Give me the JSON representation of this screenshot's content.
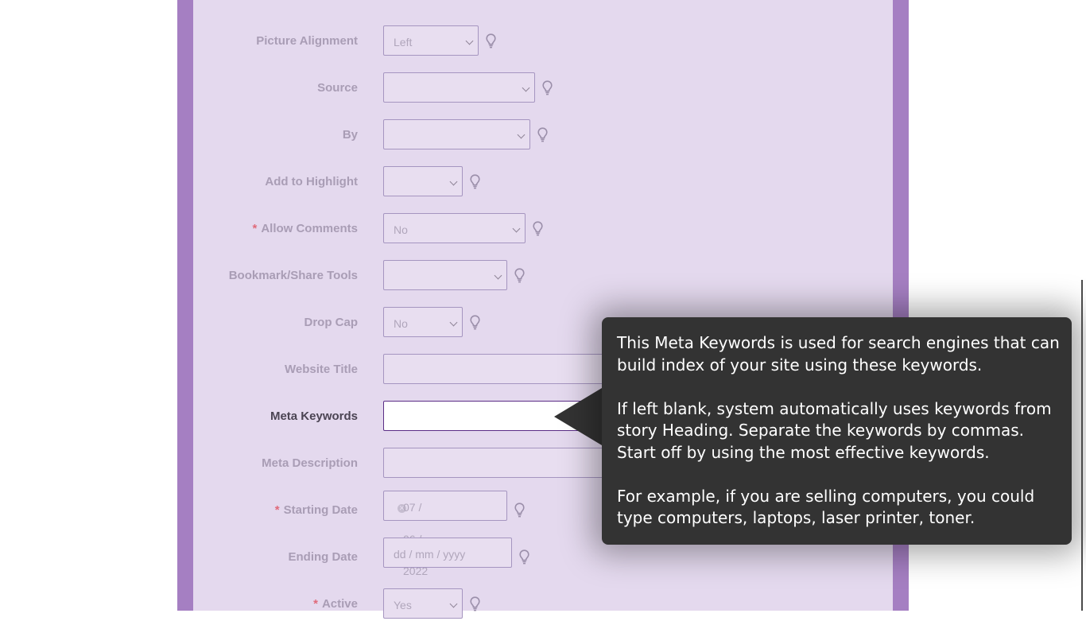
{
  "form": {
    "fields": [
      {
        "label": "Picture Alignment",
        "value": "Left"
      },
      {
        "label": "Source",
        "value": ""
      },
      {
        "label": "By",
        "value": ""
      },
      {
        "label": "Add to Highlight",
        "value": ""
      },
      {
        "label": "Allow Comments",
        "required": "*",
        "value": "No"
      },
      {
        "label": "Bookmark/Share Tools",
        "value": ""
      },
      {
        "label": "Drop Cap",
        "value": "No"
      },
      {
        "label": "Website Title",
        "value": ""
      },
      {
        "label": "Meta Keywords",
        "value": ""
      },
      {
        "label": "Meta Description",
        "value": ""
      },
      {
        "label": "Starting Date",
        "required": "*",
        "value": "07 / 06 / 2022"
      },
      {
        "label": "Ending Date",
        "placeholder": "dd / mm / yyyy"
      },
      {
        "label": "Active",
        "required": "*",
        "value": "Yes"
      }
    ]
  },
  "tooltip": {
    "paragraphs": [
      "This Meta Keywords is used for search engines that can build index of your site using these keywords.",
      "If left blank, system automatically uses keywords from story Heading. Separate the keywords by commas. Start off by using the most effective keywords.",
      "For example, if you are selling computers, you could type computers, laptops, laser printer, toner."
    ]
  },
  "colors": {
    "frame": "#a57fc2",
    "panel": "#e4d9ee",
    "tooltip_bg": "#333333",
    "focus_border": "#5a2d86"
  },
  "icons": {
    "help": "lightbulb-icon",
    "clear": "clear-icon",
    "dropdown": "chevron-down-icon"
  }
}
